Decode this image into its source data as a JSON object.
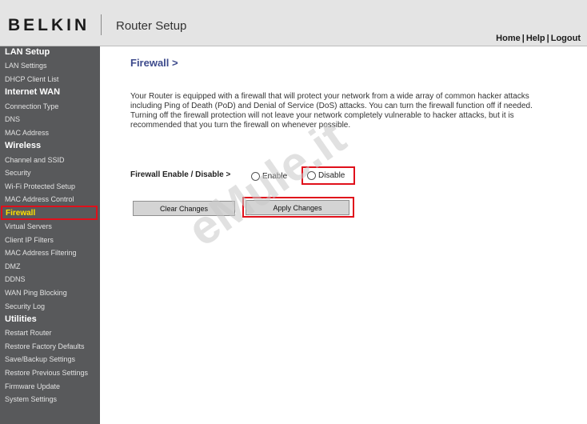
{
  "header": {
    "logo": "BELKIN",
    "title": "Router Setup",
    "links": [
      "Home",
      "Help",
      "Logout"
    ],
    "link_separator": "|"
  },
  "sidebar": {
    "lan_heading": "LAN Setup",
    "lan_items": [
      "LAN Settings",
      "DHCP Client List"
    ],
    "wan_heading": "Internet WAN",
    "wan_items": [
      "Connection Type",
      "DNS",
      "MAC Address"
    ],
    "wireless_heading": "Wireless",
    "wireless_items": [
      "Channel and SSID",
      "Security",
      "Wi-Fi Protected Setup",
      "MAC Address Control"
    ],
    "firewall_heading": "Firewall",
    "firewall_items": [
      "Virtual Servers",
      "Client IP Filters",
      "MAC Address Filtering",
      "DMZ",
      "DDNS",
      "WAN Ping Blocking",
      "Security Log"
    ],
    "utilities_heading": "Utilities",
    "utilities_items": [
      "Restart Router",
      "Restore Factory Defaults",
      "Save/Backup Settings",
      "Restore Previous Settings",
      "Firmware Update",
      "System Settings"
    ]
  },
  "main": {
    "title": "Firewall >",
    "description": "Your Router is equipped with a firewall that will protect your network from a wide array of common hacker attacks including Ping of Death (PoD) and Denial of Service (DoS) attacks. You can turn the firewall function off if needed. Turning off the firewall protection will not leave your network completely vulnerable to hacker attacks, but it is recommended that you turn the firewall on whenever possible.",
    "firewall_label": "Firewall Enable / Disable >",
    "enable_label": "Enable",
    "disable_label": "Disable",
    "clear_button": "Clear Changes",
    "apply_button": "Apply Changes"
  },
  "watermark": "eMule.it",
  "colors": {
    "highlight_red": "#e0101b",
    "active_nav_text": "#ffe100",
    "sidebar_bg": "#58595b",
    "title_blue": "#3d4a8c"
  }
}
